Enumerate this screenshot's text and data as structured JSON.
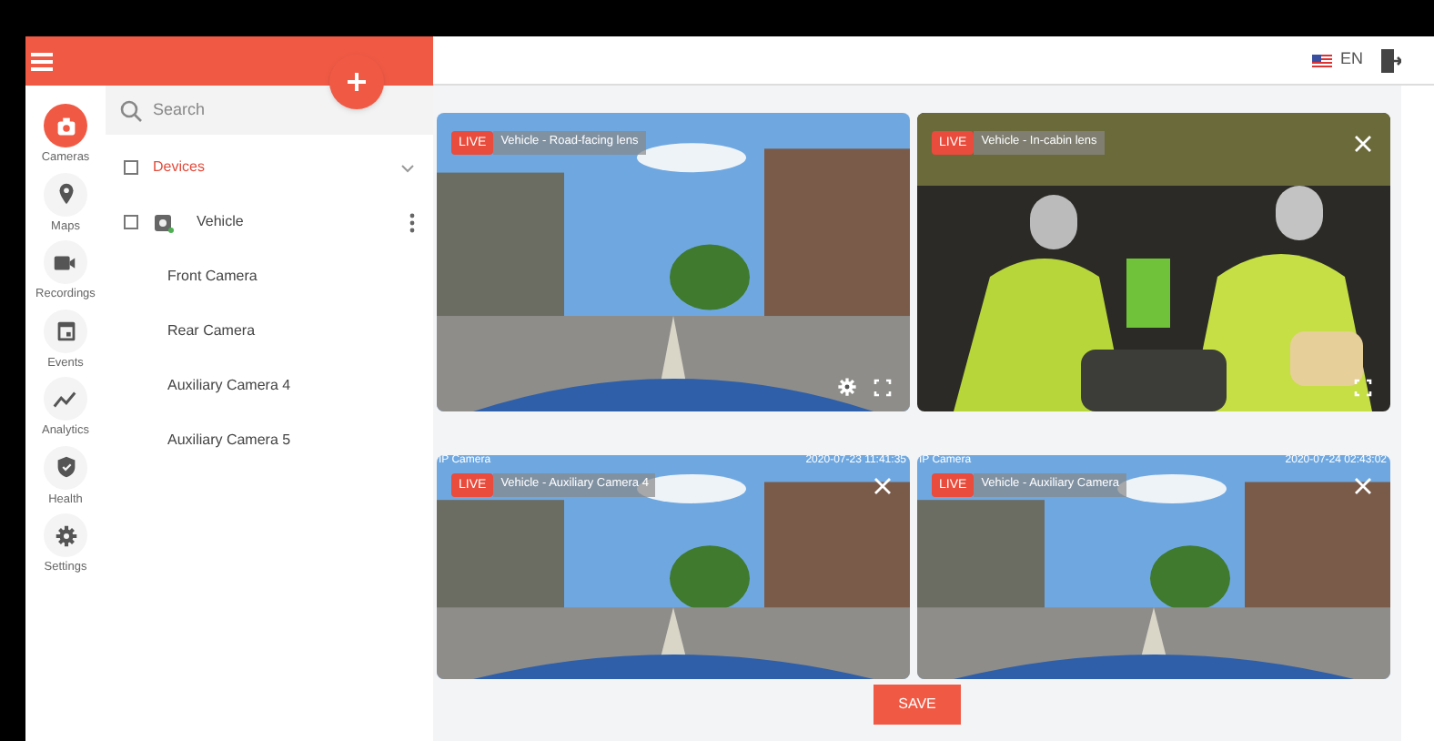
{
  "header": {
    "language": "EN"
  },
  "nav": [
    {
      "label": "Cameras",
      "kind": "camera",
      "selected": true
    },
    {
      "label": "Maps",
      "kind": "pin",
      "selected": false
    },
    {
      "label": "Recordings",
      "kind": "video",
      "selected": false
    },
    {
      "label": "Events",
      "kind": "calendar",
      "selected": false
    },
    {
      "label": "Analytics",
      "kind": "chart",
      "selected": false
    },
    {
      "label": "Health",
      "kind": "shield",
      "selected": false
    },
    {
      "label": "Settings",
      "kind": "gear",
      "selected": false
    }
  ],
  "search": {
    "placeholder": "Search"
  },
  "tree": {
    "label": "Devices",
    "checked": false,
    "children": [
      {
        "label": "Vehicle",
        "checked": false,
        "online": true,
        "children": [
          {
            "label": "Front Camera"
          },
          {
            "label": "Rear Camera"
          },
          {
            "label": "Auxiliary Camera 4"
          },
          {
            "label": "Auxiliary Camera 5"
          }
        ]
      }
    ]
  },
  "tiles": [
    {
      "badge": "LIVE",
      "title": "Vehicle - Road-facing lens",
      "settings": true,
      "fullscreen": true,
      "closable": false
    },
    {
      "badge": "LIVE",
      "title": "Vehicle - In-cabin lens",
      "settings": false,
      "fullscreen": true,
      "closable": true
    },
    {
      "badge": "LIVE",
      "title": "Vehicle - Auxiliary Camera 4",
      "source": "IP Camera",
      "time": "2020-07-23 11:41:35",
      "settings": false,
      "fullscreen": false,
      "closable": true
    },
    {
      "badge": "LIVE",
      "title": "Vehicle - Auxiliary Camera",
      "source": "IP Camera",
      "time": "2020-07-24 02:43:02",
      "settings": false,
      "fullscreen": false,
      "closable": true
    }
  ],
  "save_button": "SAVE"
}
